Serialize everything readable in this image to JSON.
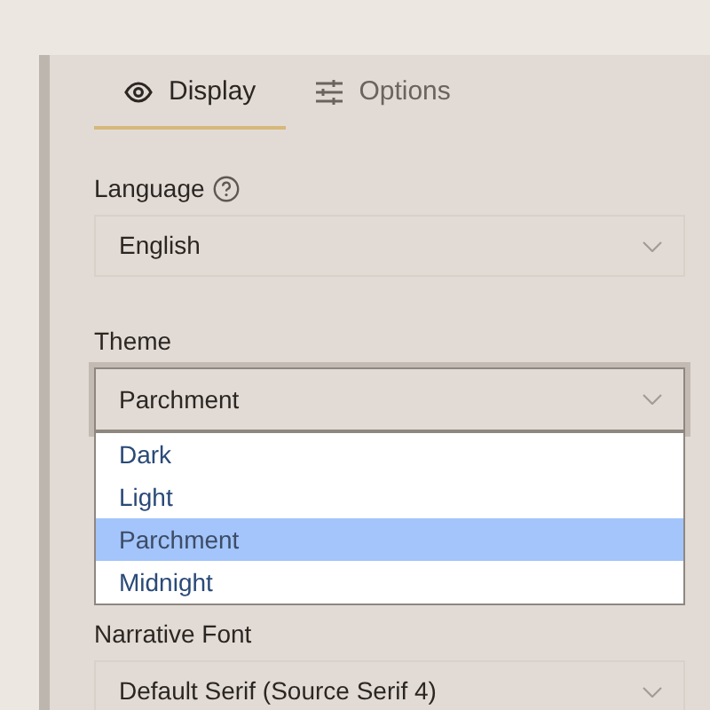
{
  "tabs": [
    {
      "label": "Display",
      "selected": true
    },
    {
      "label": "Options",
      "selected": false
    }
  ],
  "fields": [
    {
      "label": "Language",
      "help": true,
      "value": "English",
      "expanded": false
    },
    {
      "label": "Theme",
      "help": false,
      "value": "Parchment",
      "expanded": true,
      "options": [
        {
          "label": "Dark",
          "selected": false
        },
        {
          "label": "Light",
          "selected": false
        },
        {
          "label": "Parchment",
          "selected": true
        },
        {
          "label": "Midnight",
          "selected": false
        }
      ]
    },
    {
      "label": "Narrative Font",
      "help": false,
      "value": "Default Serif (Source Serif 4)",
      "expanded": false
    }
  ]
}
